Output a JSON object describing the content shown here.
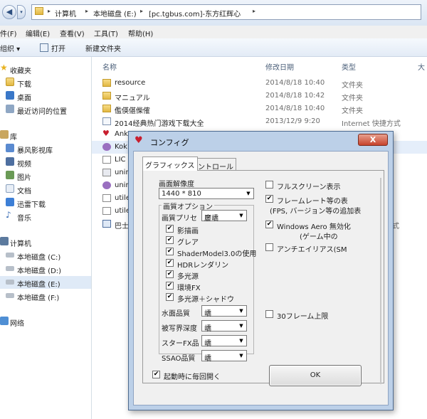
{
  "address": {
    "crumbs": [
      "计算机",
      "本地磁盘 (E:)",
      "[pc.tgbus.com]-东方红辉心"
    ]
  },
  "menu": [
    "件(F)",
    "编辑(E)",
    "查看(V)",
    "工具(T)",
    "帮助(H)"
  ],
  "toolbar": {
    "organize": "组织",
    "open": "打开",
    "new_folder": "新建文件夹"
  },
  "nav": {
    "favorites": "收藏夹",
    "fav_items": [
      "下载",
      "桌面",
      "最近访问的位置"
    ],
    "library": "库",
    "lib_items": [
      "暴风影视库",
      "视频",
      "图片",
      "文档",
      "迅雷下载",
      "音乐"
    ],
    "computer": "计算机",
    "drives": [
      "本地磁盘 (C:)",
      "本地磁盘 (D:)",
      "本地磁盘 (E:)",
      "本地磁盘 (F:)"
    ],
    "network": "网络"
  },
  "columns": {
    "name": "名称",
    "date": "修改日期",
    "type": "类型",
    "size": "大"
  },
  "files": [
    {
      "name": "resource",
      "date": "2014/8/18 10:40",
      "type": "文件夹"
    },
    {
      "name": "マニュアル",
      "date": "2014/8/18 10:42",
      "type": "文件夹"
    },
    {
      "name": "儖偀偡偨傕",
      "date": "2014/8/18 10:40",
      "type": "文件夹"
    },
    {
      "name": "2014经典热门游戏下载大全",
      "date": "2013/12/9 9:20",
      "type": "Internet 快捷方式"
    },
    {
      "name": "Ank",
      "date": "",
      "type": ""
    },
    {
      "name": "Kok",
      "date": "",
      "type": ""
    },
    {
      "name": "LIC",
      "date": "",
      "type": ""
    },
    {
      "name": "unin",
      "date": "",
      "type": ""
    },
    {
      "name": "unin",
      "date": "",
      "type": ""
    },
    {
      "name": "utile",
      "date": "",
      "type": ""
    },
    {
      "name": "utile",
      "date": "",
      "type": ""
    },
    {
      "name": "巴士",
      "date": "",
      "type": "式"
    }
  ],
  "dialog": {
    "title": "コンフィグ",
    "close": "X",
    "tabs": [
      "グラフィックス",
      "コントロール"
    ],
    "resolution_label": "画面解像度",
    "resolution_value": "1440 * 810",
    "options_group": "画質オプション",
    "preset_label": "画質プリセ",
    "preset_value": "廲嶠",
    "checks": [
      "影描画",
      "グレア",
      "ShaderModel3.0の使用",
      "HDRレンダリン",
      "多光源",
      "環境FX",
      "多光源＋シャドウ"
    ],
    "selects": [
      {
        "label": "水面品質",
        "value": "嶠"
      },
      {
        "label": "被写界深度",
        "value": "嶠"
      },
      {
        "label": "スターFX品",
        "value": "嶠"
      },
      {
        "label": "SSAO品質",
        "value": "嶠"
      }
    ],
    "right": {
      "fullscreen": "フルスクリーン表示",
      "fps_line1": "フレームレート等の表",
      "fps_line2": "(FPS, バージョン等の追加表",
      "aero_line1": "Windows Aero 無効化",
      "aero_line2": "(ゲーム中の",
      "antialias": "アンチエイリアス(SM",
      "limit30": "30フレーム上限"
    },
    "startup": "起動時に毎回開く",
    "ok": "OK"
  }
}
